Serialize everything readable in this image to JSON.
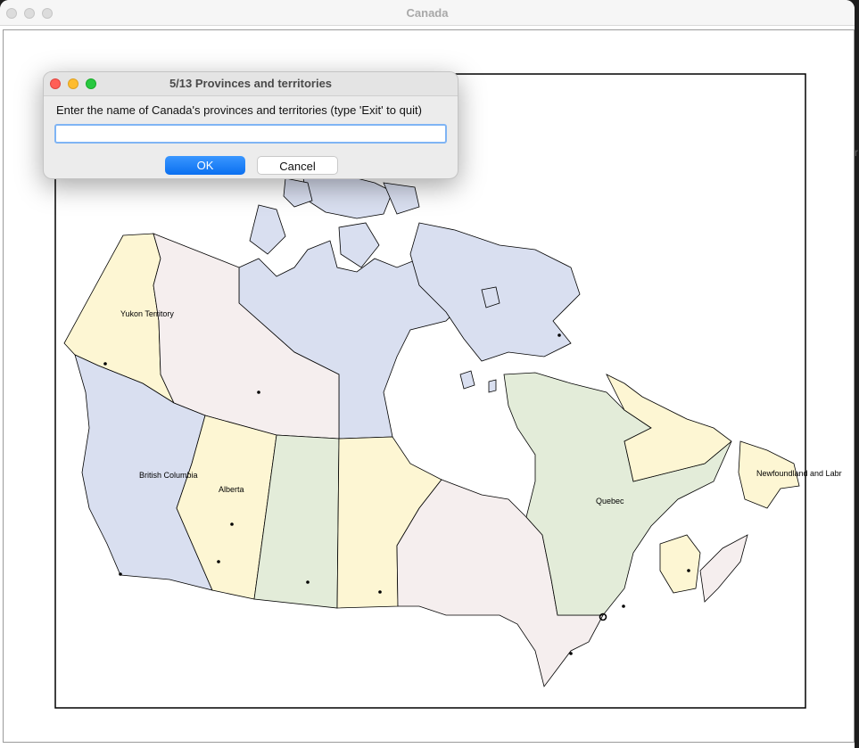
{
  "window": {
    "title": "Canada"
  },
  "edge_glyph": "r",
  "map": {
    "colors": {
      "yellow": "#fdf6d3",
      "pink": "#f5eeee",
      "blue": "#d9dff0",
      "green": "#e3ecd9",
      "stroke": "#000000"
    },
    "labels": {
      "yukon": "Yukon Territory",
      "british_columbia": "British Columbia",
      "alberta": "Alberta",
      "quebec": "Quebec",
      "newfoundland": "Newfoundland and Labr"
    }
  },
  "dialog": {
    "title": "5/13 Provinces and territories",
    "prompt": "Enter the name of Canada's provinces and territories (type 'Exit' to quit)",
    "input_value": "",
    "ok_label": "OK",
    "cancel_label": "Cancel"
  }
}
